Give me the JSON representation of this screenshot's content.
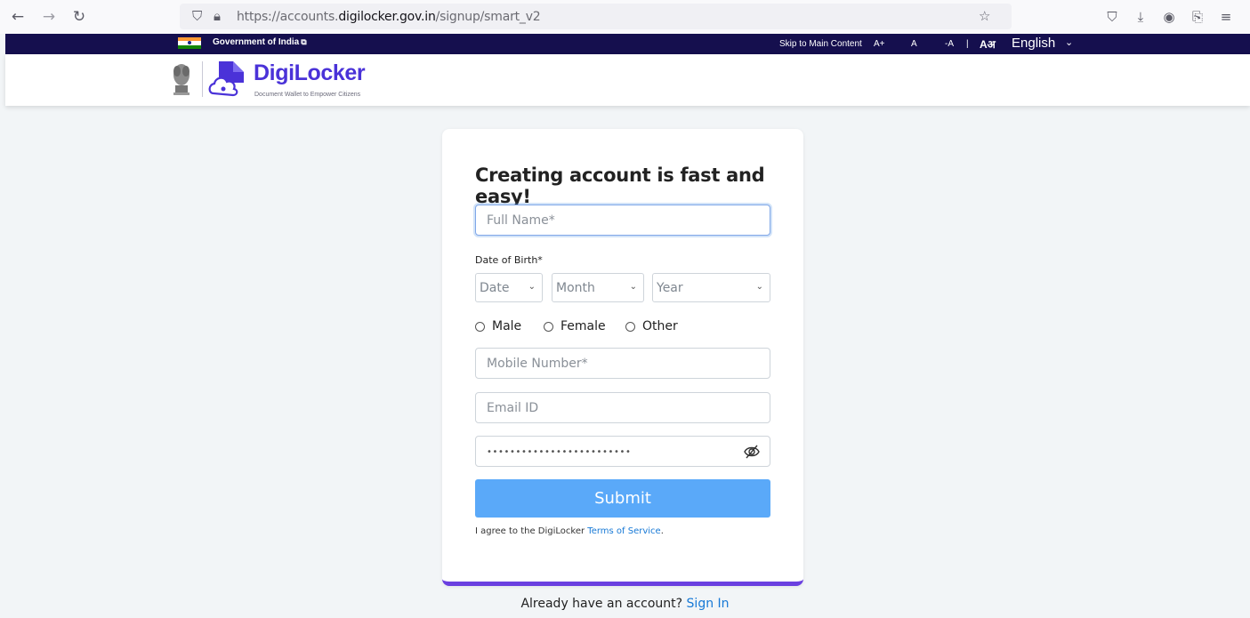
{
  "browser": {
    "url_prefix": "https://accounts.",
    "url_domain": "digilocker.gov.in",
    "url_path": "/signup/smart_v2",
    "icons": [
      "back-icon",
      "forward-icon",
      "reload-icon",
      "shield-icon",
      "lock-icon",
      "star-icon",
      "pocket-icon",
      "download-icon",
      "account-icon",
      "extensions-icon",
      "menu-icon"
    ]
  },
  "gov_strip": {
    "label": "Government of India",
    "skip_link": "Skip to Main Content",
    "font_increase": "A+",
    "font_normal": "A",
    "font_decrease": "-A",
    "separator": "|",
    "language": "English"
  },
  "header": {
    "title": "DigiLocker",
    "tagline": "Document Wallet to Empower Citizens",
    "brand_color": "#4a32d8"
  },
  "form": {
    "title": "Creating account is fast and easy!",
    "full_name_placeholder": "Full Name*",
    "dob_label": "Date of Birth*",
    "date_placeholder": "Date",
    "month_placeholder": "Month",
    "year_placeholder": "Year",
    "gender_options": [
      "Male",
      "Female",
      "Other"
    ],
    "mobile_placeholder": "Mobile Number*",
    "email_placeholder": "Email ID",
    "password_mask": "•••••••••••••••••••••••••",
    "submit_label": "Submit",
    "terms_prefix": "I agree to the DigiLocker ",
    "terms_link": "Terms of Service",
    "terms_suffix": "."
  },
  "footer": {
    "signin_prefix": "Already have an account? ",
    "signin_link": "Sign In"
  }
}
